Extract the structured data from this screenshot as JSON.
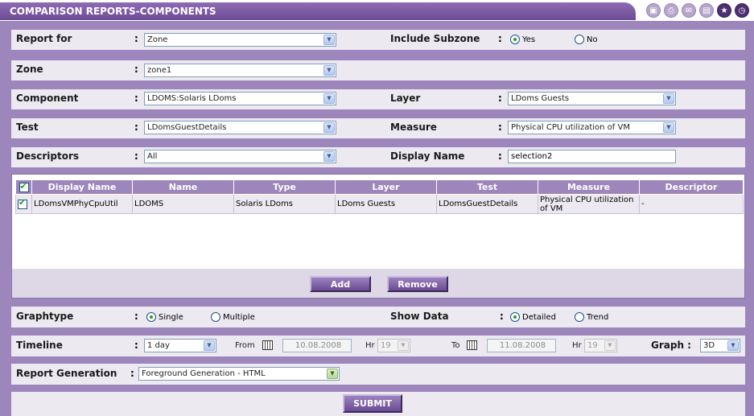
{
  "title": "COMPARISON REPORTS-COMPONENTS",
  "title_icons": [
    "save-icon",
    "print-icon",
    "mail-icon",
    "db-icon",
    "star-icon",
    "clock-icon"
  ],
  "report_for": {
    "label": "Report for",
    "value": "Zone"
  },
  "include_subzone": {
    "label": "Include Subzone",
    "yes": "Yes",
    "no": "No",
    "selected": "Yes"
  },
  "zone": {
    "label": "Zone",
    "value": "zone1"
  },
  "component": {
    "label": "Component",
    "value": "LDOMS:Solaris LDoms"
  },
  "layer": {
    "label": "Layer",
    "value": "LDoms Guests"
  },
  "test": {
    "label": "Test",
    "value": "LDomsGuestDetails"
  },
  "measure": {
    "label": "Measure",
    "value": "Physical CPU utilization of VM"
  },
  "descriptors": {
    "label": "Descriptors",
    "value": "All"
  },
  "display_name": {
    "label": "Display Name",
    "value": "selection2"
  },
  "table": {
    "columns": [
      "Display Name",
      "Name",
      "Type",
      "Layer",
      "Test",
      "Measure",
      "Descriptor"
    ],
    "rows": [
      [
        "LDomsVMPhyCpuUtil",
        "LDOMS",
        "Solaris LDoms",
        "LDoms Guests",
        "LDomsGuestDetails",
        "Physical CPU utilization of VM",
        "-"
      ]
    ],
    "add_label": "Add",
    "remove_label": "Remove"
  },
  "graphtype": {
    "label": "Graphtype",
    "single": "Single",
    "multiple": "Multiple",
    "selected": "Single"
  },
  "show_data": {
    "label": "Show Data",
    "detailed": "Detailed",
    "trend": "Trend",
    "selected": "Detailed"
  },
  "timeline": {
    "label": "Timeline",
    "value": "1 day",
    "from_label": "From",
    "from_date": "10.08.2008",
    "hr_label": "Hr",
    "from_hr": "19",
    "to_label": "To",
    "to_date": "11.08.2008",
    "to_hr": "19",
    "graph_label": "Graph :",
    "graph_value": "3D"
  },
  "report_generation": {
    "label": "Report Generation",
    "value": "Foreground Generation - HTML"
  },
  "submit_label": "SUBMIT",
  "colon": ":"
}
